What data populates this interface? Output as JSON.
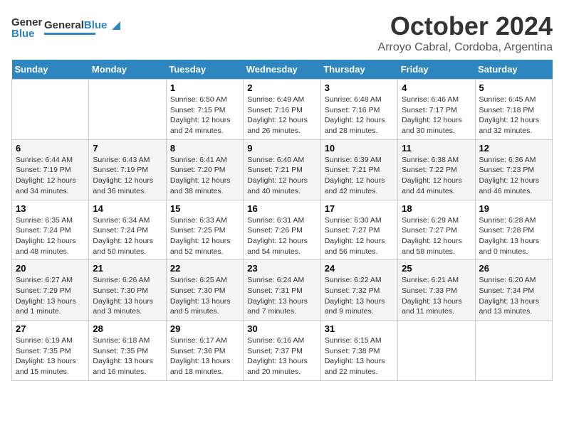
{
  "header": {
    "logo_general": "General",
    "logo_blue": "Blue",
    "title": "October 2024",
    "subtitle": "Arroyo Cabral, Cordoba, Argentina"
  },
  "weekdays": [
    "Sunday",
    "Monday",
    "Tuesday",
    "Wednesday",
    "Thursday",
    "Friday",
    "Saturday"
  ],
  "weeks": [
    [
      {
        "day": "",
        "info": ""
      },
      {
        "day": "",
        "info": ""
      },
      {
        "day": "1",
        "info": "Sunrise: 6:50 AM\nSunset: 7:15 PM\nDaylight: 12 hours\nand 24 minutes."
      },
      {
        "day": "2",
        "info": "Sunrise: 6:49 AM\nSunset: 7:16 PM\nDaylight: 12 hours\nand 26 minutes."
      },
      {
        "day": "3",
        "info": "Sunrise: 6:48 AM\nSunset: 7:16 PM\nDaylight: 12 hours\nand 28 minutes."
      },
      {
        "day": "4",
        "info": "Sunrise: 6:46 AM\nSunset: 7:17 PM\nDaylight: 12 hours\nand 30 minutes."
      },
      {
        "day": "5",
        "info": "Sunrise: 6:45 AM\nSunset: 7:18 PM\nDaylight: 12 hours\nand 32 minutes."
      }
    ],
    [
      {
        "day": "6",
        "info": "Sunrise: 6:44 AM\nSunset: 7:19 PM\nDaylight: 12 hours\nand 34 minutes."
      },
      {
        "day": "7",
        "info": "Sunrise: 6:43 AM\nSunset: 7:19 PM\nDaylight: 12 hours\nand 36 minutes."
      },
      {
        "day": "8",
        "info": "Sunrise: 6:41 AM\nSunset: 7:20 PM\nDaylight: 12 hours\nand 38 minutes."
      },
      {
        "day": "9",
        "info": "Sunrise: 6:40 AM\nSunset: 7:21 PM\nDaylight: 12 hours\nand 40 minutes."
      },
      {
        "day": "10",
        "info": "Sunrise: 6:39 AM\nSunset: 7:21 PM\nDaylight: 12 hours\nand 42 minutes."
      },
      {
        "day": "11",
        "info": "Sunrise: 6:38 AM\nSunset: 7:22 PM\nDaylight: 12 hours\nand 44 minutes."
      },
      {
        "day": "12",
        "info": "Sunrise: 6:36 AM\nSunset: 7:23 PM\nDaylight: 12 hours\nand 46 minutes."
      }
    ],
    [
      {
        "day": "13",
        "info": "Sunrise: 6:35 AM\nSunset: 7:24 PM\nDaylight: 12 hours\nand 48 minutes."
      },
      {
        "day": "14",
        "info": "Sunrise: 6:34 AM\nSunset: 7:24 PM\nDaylight: 12 hours\nand 50 minutes."
      },
      {
        "day": "15",
        "info": "Sunrise: 6:33 AM\nSunset: 7:25 PM\nDaylight: 12 hours\nand 52 minutes."
      },
      {
        "day": "16",
        "info": "Sunrise: 6:31 AM\nSunset: 7:26 PM\nDaylight: 12 hours\nand 54 minutes."
      },
      {
        "day": "17",
        "info": "Sunrise: 6:30 AM\nSunset: 7:27 PM\nDaylight: 12 hours\nand 56 minutes."
      },
      {
        "day": "18",
        "info": "Sunrise: 6:29 AM\nSunset: 7:27 PM\nDaylight: 12 hours\nand 58 minutes."
      },
      {
        "day": "19",
        "info": "Sunrise: 6:28 AM\nSunset: 7:28 PM\nDaylight: 13 hours\nand 0 minutes."
      }
    ],
    [
      {
        "day": "20",
        "info": "Sunrise: 6:27 AM\nSunset: 7:29 PM\nDaylight: 13 hours\nand 1 minute."
      },
      {
        "day": "21",
        "info": "Sunrise: 6:26 AM\nSunset: 7:30 PM\nDaylight: 13 hours\nand 3 minutes."
      },
      {
        "day": "22",
        "info": "Sunrise: 6:25 AM\nSunset: 7:30 PM\nDaylight: 13 hours\nand 5 minutes."
      },
      {
        "day": "23",
        "info": "Sunrise: 6:24 AM\nSunset: 7:31 PM\nDaylight: 13 hours\nand 7 minutes."
      },
      {
        "day": "24",
        "info": "Sunrise: 6:22 AM\nSunset: 7:32 PM\nDaylight: 13 hours\nand 9 minutes."
      },
      {
        "day": "25",
        "info": "Sunrise: 6:21 AM\nSunset: 7:33 PM\nDaylight: 13 hours\nand 11 minutes."
      },
      {
        "day": "26",
        "info": "Sunrise: 6:20 AM\nSunset: 7:34 PM\nDaylight: 13 hours\nand 13 minutes."
      }
    ],
    [
      {
        "day": "27",
        "info": "Sunrise: 6:19 AM\nSunset: 7:35 PM\nDaylight: 13 hours\nand 15 minutes."
      },
      {
        "day": "28",
        "info": "Sunrise: 6:18 AM\nSunset: 7:35 PM\nDaylight: 13 hours\nand 16 minutes."
      },
      {
        "day": "29",
        "info": "Sunrise: 6:17 AM\nSunset: 7:36 PM\nDaylight: 13 hours\nand 18 minutes."
      },
      {
        "day": "30",
        "info": "Sunrise: 6:16 AM\nSunset: 7:37 PM\nDaylight: 13 hours\nand 20 minutes."
      },
      {
        "day": "31",
        "info": "Sunrise: 6:15 AM\nSunset: 7:38 PM\nDaylight: 13 hours\nand 22 minutes."
      },
      {
        "day": "",
        "info": ""
      },
      {
        "day": "",
        "info": ""
      }
    ]
  ]
}
